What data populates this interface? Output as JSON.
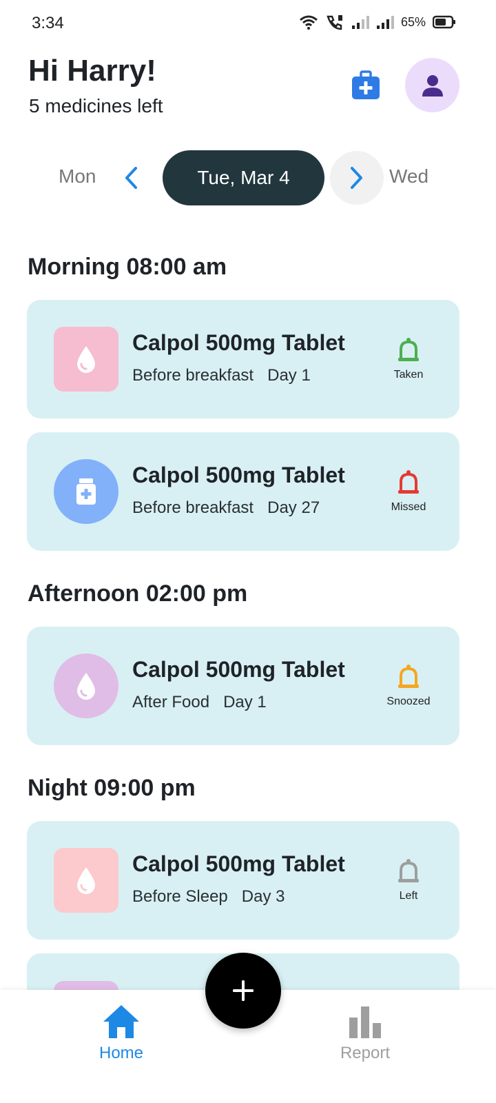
{
  "status_bar": {
    "time": "3:34",
    "battery": "65%"
  },
  "header": {
    "greeting": "Hi Harry!",
    "subtitle": "5 medicines left"
  },
  "date_nav": {
    "prev_day": "Mon",
    "current": "Tue, Mar 4",
    "next_day": "Wed"
  },
  "sections": [
    {
      "title": "Morning 08:00 am",
      "items": [
        {
          "name": "Calpol 500mg Tablet",
          "timing": "Before breakfast",
          "day": "Day 1",
          "status": "Taken",
          "thumb_color": "#f6bcd0",
          "thumb_shape": "square",
          "thumb_icon": "drop-icon",
          "status_color": "#4caf50"
        },
        {
          "name": "Calpol 500mg Tablet",
          "timing": "Before breakfast",
          "day": "Day 27",
          "status": "Missed",
          "thumb_color": "#82b1fa",
          "thumb_shape": "circle",
          "thumb_icon": "pill-bottle-icon",
          "status_color": "#e53935"
        }
      ]
    },
    {
      "title": "Afternoon 02:00 pm",
      "items": [
        {
          "name": "Calpol 500mg Tablet",
          "timing": "After Food",
          "day": "Day 1",
          "status": "Snoozed",
          "thumb_color": "#e0bde6",
          "thumb_shape": "circle",
          "thumb_icon": "drop-icon",
          "status_color": "#f5a623"
        }
      ]
    },
    {
      "title": "Night 09:00 pm",
      "items": [
        {
          "name": "Calpol 500mg Tablet",
          "timing": "Before Sleep",
          "day": "Day 3",
          "status": "Left",
          "thumb_color": "#fcc9cd",
          "thumb_shape": "square",
          "thumb_icon": "drop-icon",
          "status_color": "#9e9e9e"
        }
      ]
    }
  ],
  "bottom_nav": {
    "home_label": "Home",
    "report_label": "Report"
  },
  "colors": {
    "accent": "#1e88e5",
    "card_bg": "#d8f0f3",
    "pill_bg": "#22363d"
  }
}
